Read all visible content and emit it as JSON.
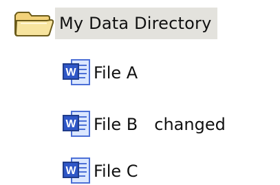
{
  "tree": {
    "root": {
      "label": "My Data Directory",
      "icon": "folder-icon"
    },
    "files": [
      {
        "label": "File A",
        "icon": "word-document-icon",
        "status": ""
      },
      {
        "label": "File B",
        "icon": "word-document-icon",
        "status": "changed"
      },
      {
        "label": "File C",
        "icon": "word-document-icon",
        "status": ""
      }
    ]
  },
  "colors": {
    "selection_highlight": "#e3e2dd",
    "folder": "#f2d27a",
    "word_blue": "#2f57c7"
  }
}
